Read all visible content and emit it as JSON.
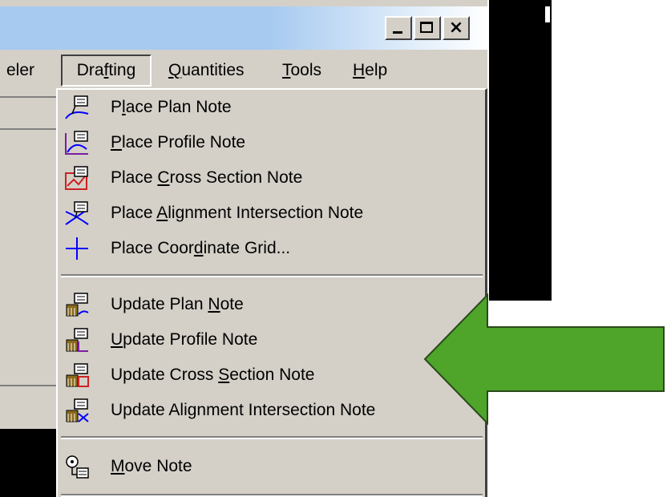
{
  "window": {
    "buttons": {
      "minimize": "_",
      "maximize": "□",
      "close": "×"
    }
  },
  "menubar": {
    "items": [
      {
        "label": "eler",
        "underline": null
      },
      {
        "label": "Drafting",
        "underline": "f"
      },
      {
        "label": "Quantities",
        "underline": "Q"
      },
      {
        "label": "Tools",
        "underline": "T"
      },
      {
        "label": "Help",
        "underline": "H"
      }
    ],
    "active": "Drafting"
  },
  "dropdown": {
    "groups": [
      [
        {
          "label": "Place Plan Note",
          "underline": "l",
          "icon": "plan-note-icon"
        },
        {
          "label": "Place Profile Note",
          "underline": "P",
          "icon": "profile-note-icon"
        },
        {
          "label": "Place Cross Section Note",
          "underline": "C",
          "icon": "cross-section-note-icon"
        },
        {
          "label": "Place Alignment Intersection Note",
          "underline": "A",
          "icon": "alignment-intersection-note-icon"
        },
        {
          "label": "Place Coordinate Grid...",
          "underline": "d",
          "icon": "coordinate-grid-icon"
        }
      ],
      [
        {
          "label": "Update Plan Note",
          "underline": "N",
          "icon": "update-plan-note-icon"
        },
        {
          "label": "Update Profile Note",
          "underline": "U",
          "icon": "update-profile-note-icon"
        },
        {
          "label": "Update Cross Section Note",
          "underline": "S",
          "icon": "update-cross-section-note-icon"
        },
        {
          "label": "Update Alignment Intersection Note",
          "underline": null,
          "icon": "update-alignment-intersection-note-icon"
        }
      ],
      [
        {
          "label": "Move Note",
          "underline": "M",
          "icon": "move-note-icon"
        }
      ]
    ]
  },
  "annotation": {
    "arrow_color": "#4ea52a",
    "arrow_stroke": "#2a4a1a",
    "direction": "left"
  }
}
